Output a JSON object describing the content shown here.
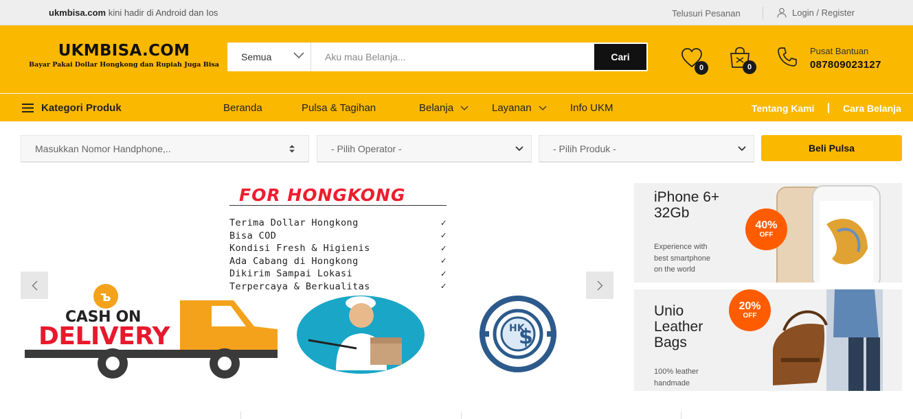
{
  "topbar": {
    "site": "ukmbisa.com",
    "promo_rest": "kini hadir di Android dan Ios",
    "track_order": "Telusuri Pesanan",
    "login": "Login / Register"
  },
  "header": {
    "brand": "UKMBISA.COM",
    "tagline": "Bayar Pakai Dollar Hongkong dan Rupiah Juga Bisa",
    "search": {
      "category": "Semua",
      "placeholder": "Aku mau Belanja...",
      "button": "Cari"
    },
    "wishlist_count": "0",
    "cart_count": "0",
    "help_label": "Pusat Bantuan",
    "help_phone": "087809023127"
  },
  "nav": {
    "categories": "Kategori Produk",
    "items": [
      {
        "label": "Beranda"
      },
      {
        "label": "Pulsa & Tagihan"
      },
      {
        "label": "Belanja"
      },
      {
        "label": "Layanan"
      },
      {
        "label": "Info UKM"
      }
    ],
    "about": "Tentang Kami",
    "how_to_buy": "Cara Belanja"
  },
  "pulsa": {
    "phone_placeholder": "Masukkan Nomor Handphone,..",
    "operator": "- Pilih Operator -",
    "product": "- Pilih Produk -",
    "button": "Beli Pulsa"
  },
  "hero": {
    "title": "FOR HONGKONG",
    "features": [
      "Terima Dollar Hongkong",
      "Bisa COD",
      "Kondisi Fresh & Higienis",
      "Ada Cabang di Hongkong",
      "Dikirim Sampai Lokasi",
      "Terpercaya & Berkualitas"
    ],
    "cod_line1": "CASH ON",
    "cod_line2": "DELIVERY",
    "hkd_letters": "HK"
  },
  "promos": [
    {
      "title_line1": "iPhone 6+",
      "title_line2": "32Gb",
      "desc_lines": [
        "Experience with",
        "best smartphone",
        "on the world"
      ],
      "discount": "40%",
      "off": "OFF"
    },
    {
      "title_line1": "Unio",
      "title_line2": "Leather",
      "title_line3": "Bags",
      "desc_lines": [
        "100% leather",
        "handmade"
      ],
      "discount": "20%",
      "off": "OFF"
    }
  ],
  "colors": {
    "brand_yellow": "#fbb800",
    "discount_orange": "#ff5c00",
    "cod_red": "#e8192c",
    "truck_orange": "#f4a21b",
    "hk_blue": "#2c5a8c"
  }
}
